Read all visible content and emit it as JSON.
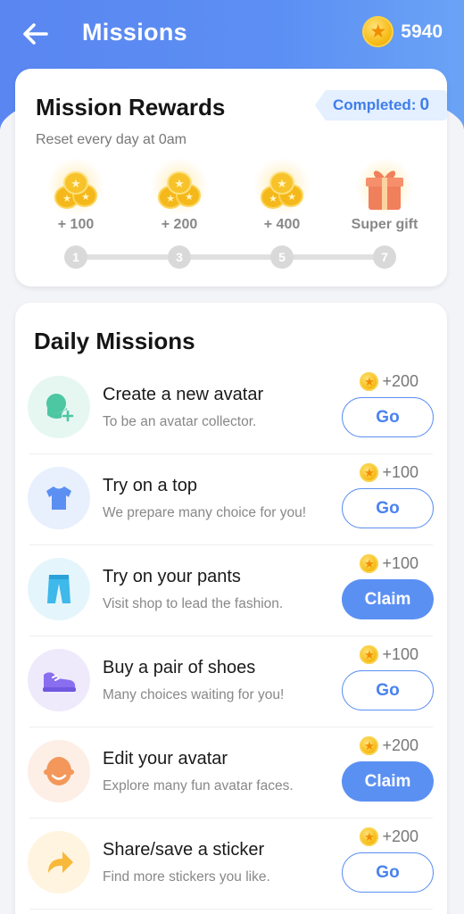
{
  "header": {
    "title": "Missions",
    "coins": "5940",
    "back_icon": "arrow-left-icon",
    "coin_icon": "gold-coin-icon"
  },
  "rewards": {
    "title": "Mission Rewards",
    "subtitle": "Reset every day at 0am",
    "completed_label": "Completed:",
    "completed_count": "0",
    "items": [
      {
        "label": "+ 100",
        "icon": "coin-pile-icon"
      },
      {
        "label": "+ 200",
        "icon": "coin-pile-icon"
      },
      {
        "label": "+ 400",
        "icon": "coin-pile-icon"
      },
      {
        "label": "Super gift",
        "icon": "gift-box-icon"
      }
    ],
    "steps": [
      "1",
      "3",
      "5",
      "7"
    ]
  },
  "missions": {
    "title": "Daily Missions",
    "items": [
      {
        "title": "Create a new avatar",
        "desc": "To be an avatar collector.",
        "reward": "+200",
        "button": "Go",
        "state": "go",
        "icon": "new-avatar-icon",
        "icon_bg": "#e6f7f2",
        "icon_color": "#4dc6a2"
      },
      {
        "title": "Try on a top",
        "desc": "We prepare many choice for you!",
        "reward": "+100",
        "button": "Go",
        "state": "go",
        "icon": "tshirt-icon",
        "icon_bg": "#e8f0fd",
        "icon_color": "#5b8ff2"
      },
      {
        "title": "Try on your pants",
        "desc": "Visit shop to lead the fashion.",
        "reward": "+100",
        "button": "Claim",
        "state": "claim",
        "icon": "pants-icon",
        "icon_bg": "#e5f5fc",
        "icon_color": "#3fb8ea"
      },
      {
        "title": "Buy a pair of shoes",
        "desc": "Many choices waiting for you!",
        "reward": "+100",
        "button": "Go",
        "state": "go",
        "icon": "sneaker-icon",
        "icon_bg": "#eeeafc",
        "icon_color": "#8a6ef0"
      },
      {
        "title": "Edit your avatar",
        "desc": "Explore many fun avatar faces.",
        "reward": "+200",
        "button": "Claim",
        "state": "claim",
        "icon": "face-icon",
        "icon_bg": "#fdeee6",
        "icon_color": "#f3975a"
      },
      {
        "title": "Share/save a sticker",
        "desc": "Find more stickers you like.",
        "reward": "+200",
        "button": "Go",
        "state": "go",
        "icon": "share-arrow-icon",
        "icon_bg": "#fff4e0",
        "icon_color": "#f8b83a"
      }
    ]
  },
  "colors": {
    "primary": "#5b8ff2",
    "coin": "#f7bd1a"
  }
}
